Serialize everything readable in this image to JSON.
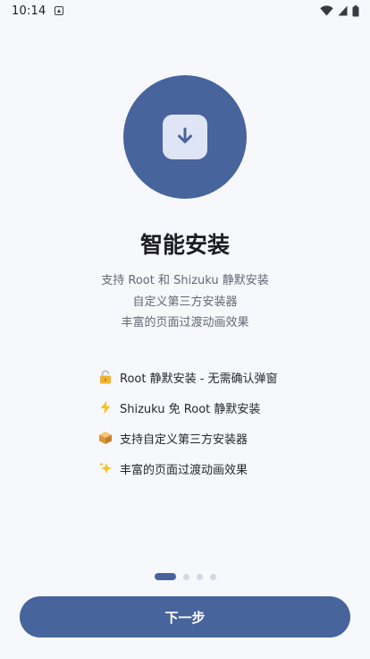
{
  "status_bar": {
    "time": "10:14",
    "icons": [
      "app-notification-icon",
      "wifi-icon",
      "cell-signal-icon",
      "battery-icon"
    ]
  },
  "hero": {
    "icon": "download-icon",
    "colors": {
      "circle": "#48649d",
      "tile": "#dfe5f5"
    }
  },
  "title": "智能安装",
  "subtitle_lines": [
    "支持 Root 和 Shizuku 静默安装",
    "自定义第三方安装器",
    "丰富的页面过渡动画效果"
  ],
  "features": [
    {
      "icon": "lock-emoji-icon",
      "text": "Root 静默安装 - 无需确认弹窗"
    },
    {
      "icon": "lightning-emoji-icon",
      "text": "Shizuku 免 Root 静默安装"
    },
    {
      "icon": "package-emoji-icon",
      "text": "支持自定义第三方安装器"
    },
    {
      "icon": "sparkles-emoji-icon",
      "text": "丰富的页面过渡动画效果"
    }
  ],
  "pager": {
    "total": 4,
    "current": 1
  },
  "next_button": {
    "label": "下一步",
    "color": "#48649d"
  }
}
